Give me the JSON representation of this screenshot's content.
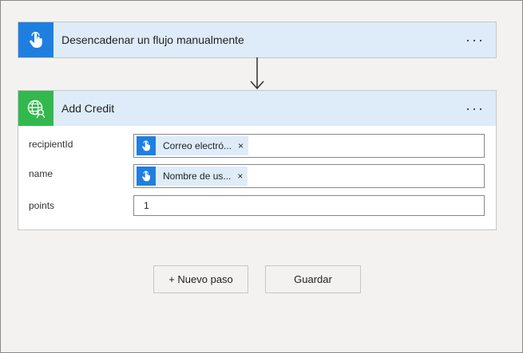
{
  "trigger": {
    "title": "Desencadenar un flujo manualmente",
    "menu": "···",
    "icon": "touch-icon",
    "color": "#1f7fe0"
  },
  "action": {
    "title": "Add Credit",
    "menu": "···",
    "icon": "globe-person-icon",
    "color": "#33b84e",
    "fields": [
      {
        "label": "recipientId",
        "token_text": "Correo electró...",
        "token_close": "×"
      },
      {
        "label": "name",
        "token_text": "Nombre de us...",
        "token_close": "×"
      },
      {
        "label": "points",
        "value": "1"
      }
    ]
  },
  "buttons": {
    "new_step": "+ Nuevo paso",
    "save": "Guardar"
  }
}
